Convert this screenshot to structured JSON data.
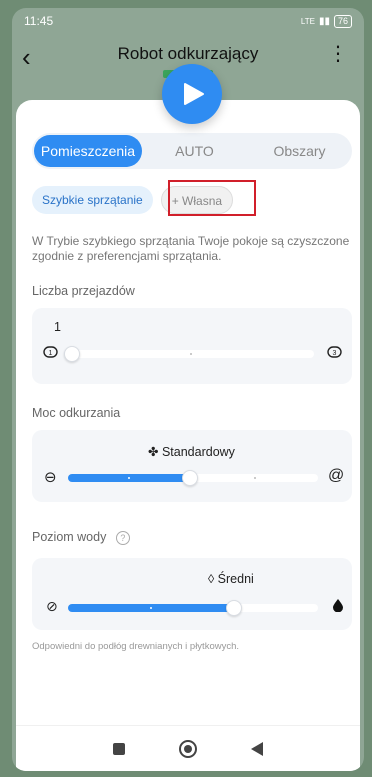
{
  "status_bar": {
    "time": "11:45",
    "signal": "LTE",
    "battery": "76"
  },
  "header": {
    "title": "Robot odkurzający",
    "back_icon": "back-arrow-icon",
    "menu_icon": "more-vertical-icon"
  },
  "play_button": {
    "icon": "play-icon",
    "color": "#2f8cf2"
  },
  "tabs": [
    {
      "label": "Pomieszczenia",
      "active": true
    },
    {
      "label": "AUTO",
      "active": false
    },
    {
      "label": "Obszary",
      "active": false
    }
  ],
  "chips": {
    "quick": "Szybkie sprzątanie",
    "custom": "+ Własna"
  },
  "description": "W Trybie szybkiego sprzątania Twoje pokoje są czyszczone zgodnie z preferencjami sprzątania.",
  "passes": {
    "label": "Liczba przejazdów",
    "value": "1",
    "min_icon_label": "1",
    "max_icon_label": "3",
    "level": 0
  },
  "suction": {
    "label": "Moc odkurzania",
    "value": "Standardowy",
    "level": 0.5
  },
  "water": {
    "label": "Poziom wody",
    "value": "Średni",
    "level": 0.67
  },
  "footnote": "Odpowiedni do podłóg drewnianych i płytkowych.",
  "colors": {
    "accent": "#2f8cf2",
    "highlight": "#d11f2a"
  }
}
